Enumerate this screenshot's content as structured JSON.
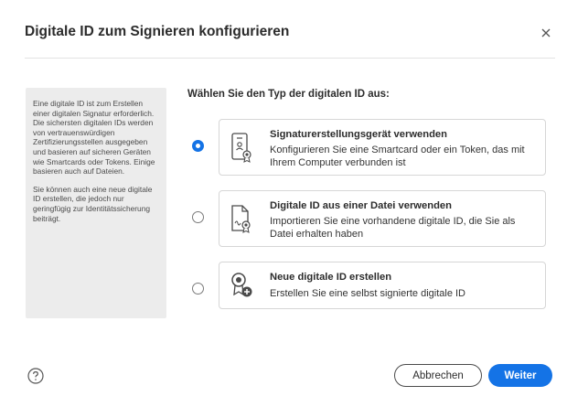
{
  "dialog": {
    "title": "Digitale ID zum Signieren konfigurieren",
    "close_icon": "close-icon"
  },
  "info_panel": {
    "paragraph1": "Eine digitale ID ist zum Erstellen einer digitalen Signatur erforderlich. Die sichersten digitalen IDs werden von vertrauenswürdigen Zertifizierungsstellen ausgegeben und basieren auf sicheren Geräten wie Smartcards oder Tokens. Einige basieren auch auf Dateien.",
    "paragraph2": "Sie können auch eine neue digitale ID erstellen, die jedoch nur geringfügig zur Identitätssicherung beiträgt."
  },
  "main": {
    "prompt": "Wählen Sie den Typ der digitalen ID aus:",
    "selected_index": 0,
    "options": [
      {
        "title": "Signaturerstellungsgerät verwenden",
        "description": "Konfigurieren Sie eine Smartcard oder ein Token, das mit Ihrem Computer verbunden ist",
        "icon": "smartcard-device-icon"
      },
      {
        "title": "Digitale ID aus einer Datei verwenden",
        "description": "Importieren Sie eine vorhandene digitale ID, die Sie als Datei erhalten haben",
        "icon": "certificate-file-icon"
      },
      {
        "title": "Neue digitale ID erstellen",
        "description": "Erstellen Sie eine selbst signierte digitale ID",
        "icon": "new-certificate-icon"
      }
    ]
  },
  "footer": {
    "help_icon": "help-icon",
    "cancel_label": "Abbrechen",
    "primary_label": "Weiter"
  },
  "colors": {
    "accent": "#1473e6",
    "panel_background": "#ececec"
  }
}
